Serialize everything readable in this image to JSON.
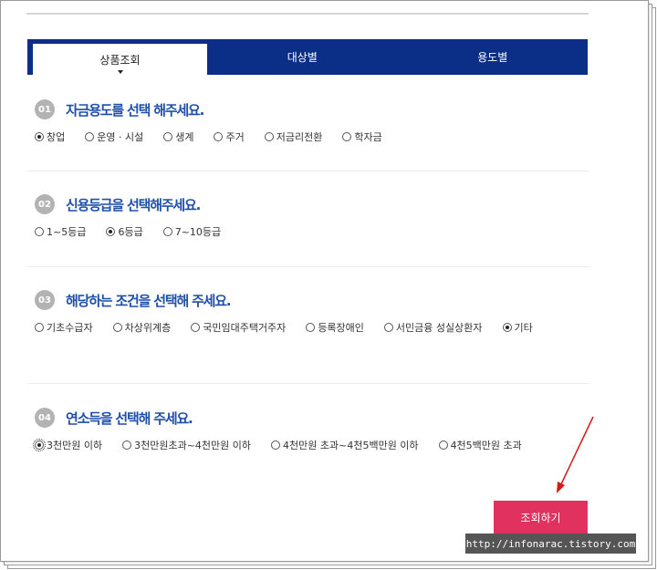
{
  "tabs": [
    {
      "label": "상품조회"
    },
    {
      "label": "대상별"
    },
    {
      "label": "용도별"
    }
  ],
  "questions": [
    {
      "num": "01",
      "title": "자금용도를 선택 해주세요.",
      "options": [
        {
          "label": "창업",
          "checked": true
        },
        {
          "label": "운영 · 시설",
          "checked": false
        },
        {
          "label": "생계",
          "checked": false
        },
        {
          "label": "주거",
          "checked": false
        },
        {
          "label": "저금리전환",
          "checked": false
        },
        {
          "label": "학자금",
          "checked": false
        }
      ]
    },
    {
      "num": "02",
      "title": "신용등급을 선택해주세요.",
      "options": [
        {
          "label": "1~5등급",
          "checked": false
        },
        {
          "label": "6등급",
          "checked": true
        },
        {
          "label": "7~10등급",
          "checked": false
        }
      ]
    },
    {
      "num": "03",
      "title": "해당하는 조건을 선택해 주세요.",
      "options": [
        {
          "label": "기초수급자",
          "checked": false
        },
        {
          "label": "차상위계층",
          "checked": false
        },
        {
          "label": "국민임대주택거주자",
          "checked": false
        },
        {
          "label": "등록장애인",
          "checked": false
        },
        {
          "label": "서민금융 성실상환자",
          "checked": false
        },
        {
          "label": "기타",
          "checked": true
        }
      ]
    },
    {
      "num": "04",
      "title": "연소득을 선택해 주세요.",
      "options": [
        {
          "label": "3천만원 이하",
          "checked": true
        },
        {
          "label": "3천만원초과~4천만원 이하",
          "checked": false
        },
        {
          "label": "4천만원 초과~4천5백만원 이하",
          "checked": false
        },
        {
          "label": "4천5백만원 초과",
          "checked": false
        }
      ]
    }
  ],
  "submit": {
    "label": "조회하기"
  },
  "watermark": {
    "text": "http://infonarac.tistory.com"
  },
  "colors": {
    "tab_bg": "#0b2f86",
    "title": "#1f4fa8",
    "button": "#e0315f",
    "arrow": "#d11a1a"
  }
}
